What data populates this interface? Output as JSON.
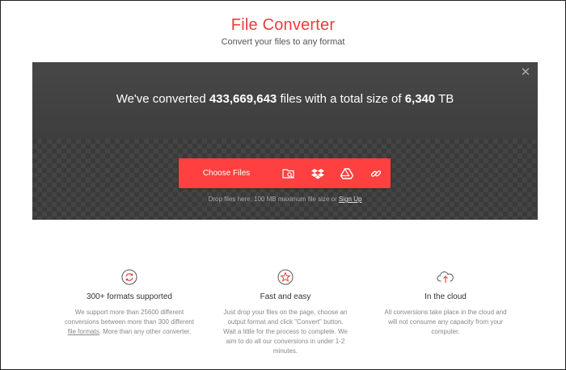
{
  "header": {
    "title": "File Converter",
    "subtitle": "Convert your files to any format"
  },
  "hero": {
    "close_icon": "close-icon",
    "stats_prefix": "We've converted",
    "files_count": "433,669,643",
    "stats_middle": "files with a total size of",
    "total_size": "6,340",
    "stats_unit": "TB",
    "choose_label": "Choose Files",
    "sources": [
      "folder-search-icon",
      "dropbox-icon",
      "google-drive-icon",
      "link-icon"
    ],
    "drop_text": "Drop files here. 100 MB maximum file size or",
    "signup_label": "Sign Up"
  },
  "features": [
    {
      "icon": "refresh-circle-icon",
      "title": "300+ formats supported",
      "desc_before": "We support more than 25600 different conversions between more than 300 different",
      "link": "file formats",
      "desc_after": ". More than any other converter."
    },
    {
      "icon": "star-circle-icon",
      "title": "Fast and easy",
      "desc": "Just drop your files on the page, choose an output format and click \"Convert\" button. Wait a little for the process to complete. We aim to do all our conversions in under 1-2 minutes."
    },
    {
      "icon": "cloud-upload-icon",
      "title": "In the cloud",
      "desc": "All conversions take place in the cloud and will not consume any capacity from your computer."
    }
  ],
  "colors": {
    "brand": "#ef3b3b",
    "button": "#ff4040",
    "hero_bg": "#3c3c3c"
  }
}
